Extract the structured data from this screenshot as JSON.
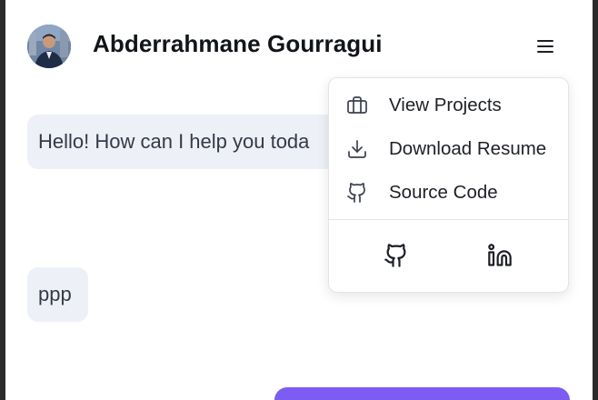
{
  "header": {
    "name": "Abderrahmane Gourragui",
    "avatar_icon": "profile-photo",
    "menu_icon": "hamburger-menu-icon"
  },
  "chat": {
    "messages": [
      {
        "text": "Hello! How can I help you toda"
      },
      {
        "text": "ppp"
      }
    ]
  },
  "menu": {
    "items": [
      {
        "label": "View Projects",
        "icon": "briefcase-icon"
      },
      {
        "label": "Download Resume",
        "icon": "download-icon"
      },
      {
        "label": "Source Code",
        "icon": "github-outline-icon"
      }
    ],
    "social": [
      {
        "icon": "github-icon"
      },
      {
        "icon": "linkedin-icon"
      }
    ]
  },
  "colors": {
    "accent": "#7c5cf2",
    "bubble": "#eef0f8",
    "text": "#111418"
  }
}
